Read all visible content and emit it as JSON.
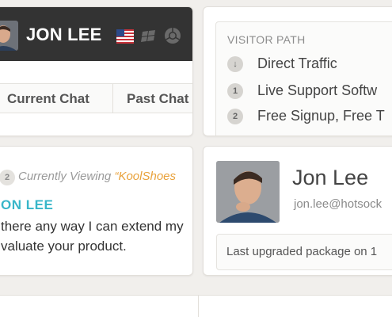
{
  "chat_header": {
    "visitor_name": "JON LEE",
    "icons": [
      "us-flag-icon",
      "windows-icon",
      "chrome-icon"
    ]
  },
  "tabs": [
    {
      "label": "Current Chat"
    },
    {
      "label": "Past Chat"
    }
  ],
  "visitor_path": {
    "title": "VISITOR PATH",
    "items": [
      {
        "badge": "↓",
        "text": "Direct Traffic"
      },
      {
        "badge": "1",
        "text": "Live Support Softw"
      },
      {
        "badge": "2",
        "text": "Free Signup, Free T"
      }
    ]
  },
  "message": {
    "viewing_badge": "2",
    "viewing_prefix": "Currently Viewing",
    "viewing_page": "“KoolShoes",
    "author": "ON LEE",
    "lines": [
      "there any way I can extend my",
      "valuate your product."
    ]
  },
  "profile": {
    "name": "Jon Lee",
    "email": "jon.lee@hotsock",
    "footer": "Last upgraded package on 1"
  },
  "colors": {
    "header_bg": "#333333",
    "author_accent": "#38b6c9",
    "viewing_accent": "#e9a23b"
  }
}
